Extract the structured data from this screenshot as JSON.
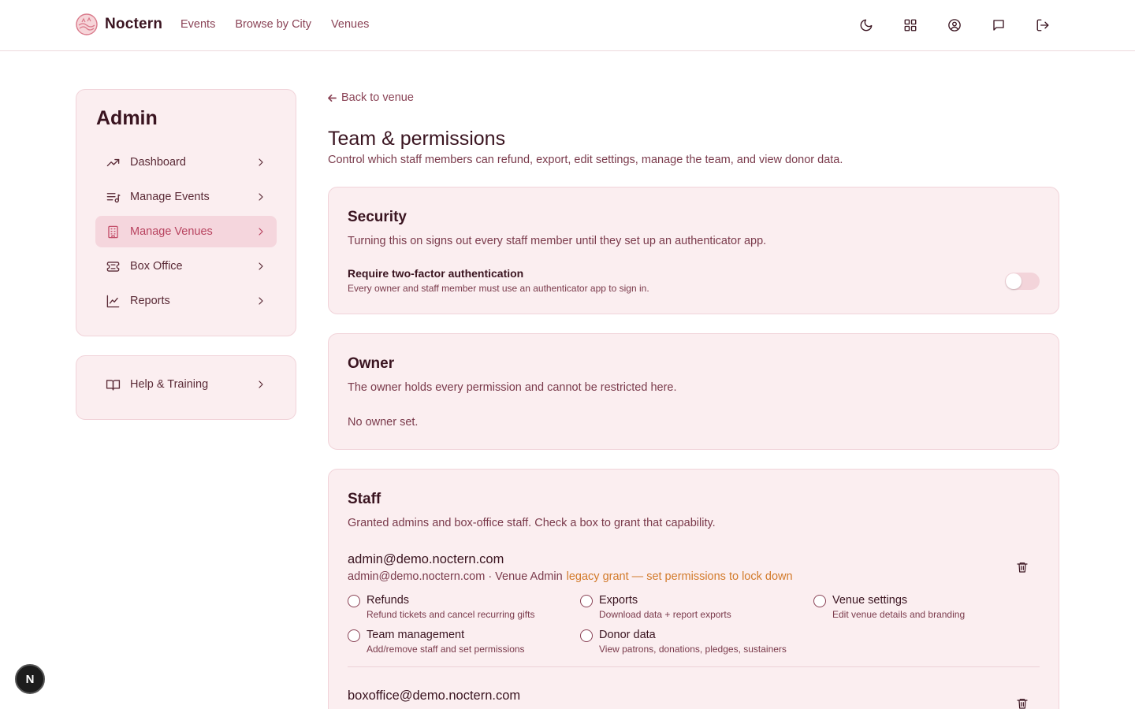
{
  "header": {
    "brand": "Noctern",
    "nav": [
      "Events",
      "Browse by City",
      "Venues"
    ],
    "icons": [
      "moon-icon",
      "grid-icon",
      "user-circle-icon",
      "message-icon",
      "logout-icon"
    ]
  },
  "sidebar": {
    "title": "Admin",
    "items": [
      {
        "label": "Dashboard",
        "icon": "trending-up-icon"
      },
      {
        "label": "Manage Events",
        "icon": "list-music-icon"
      },
      {
        "label": "Manage Venues",
        "icon": "building-icon",
        "active": true
      },
      {
        "label": "Box Office",
        "icon": "ticket-icon"
      },
      {
        "label": "Reports",
        "icon": "line-chart-icon"
      }
    ],
    "help": {
      "label": "Help & Training",
      "icon": "book-open-icon"
    }
  },
  "main": {
    "back_label": "Back to venue",
    "title": "Team & permissions",
    "subtitle": "Control which staff members can refund, export, edit settings, manage the team, and view donor data.",
    "security": {
      "title": "Security",
      "desc": "Turning this on signs out every staff member until they set up an authenticator app.",
      "toggle_label": "Require two-factor authentication",
      "toggle_hint": "Every owner and staff member must use an authenticator app to sign in.",
      "enabled": false
    },
    "owner": {
      "title": "Owner",
      "desc": "The owner holds every permission and cannot be restricted here.",
      "empty": "No owner set."
    },
    "staff": {
      "title": "Staff",
      "desc": "Granted admins and box-office staff. Check a box to grant that capability.",
      "members": [
        {
          "email": "admin@demo.noctern.com",
          "meta": "admin@demo.noctern.com · Venue Admin",
          "legacy": "legacy grant — set permissions to lock down",
          "permissions": [
            {
              "name": "Refunds",
              "desc": "Refund tickets and cancel recurring gifts",
              "checked": false
            },
            {
              "name": "Exports",
              "desc": "Download data + report exports",
              "checked": false
            },
            {
              "name": "Venue settings",
              "desc": "Edit venue details and branding",
              "checked": false
            },
            {
              "name": "Team management",
              "desc": "Add/remove staff and set permissions",
              "checked": false
            },
            {
              "name": "Donor data",
              "desc": "View patrons, donations, pledges, sustainers",
              "checked": false
            }
          ]
        },
        {
          "email": "boxoffice@demo.noctern.com"
        }
      ]
    }
  },
  "fab_label": "N",
  "colors": {
    "accent": "#b8435f",
    "card_bg": "#fbeef0",
    "legacy": "#d27a2a"
  }
}
